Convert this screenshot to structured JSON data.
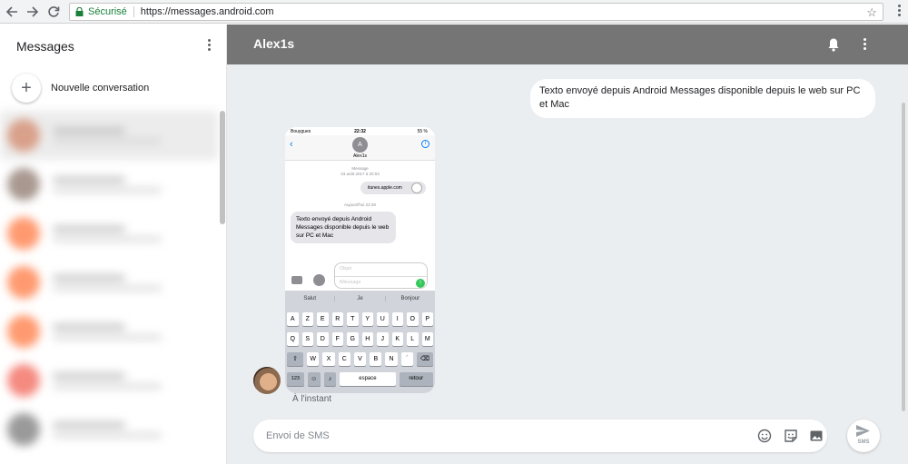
{
  "browser": {
    "secure_label": "Sécurisé",
    "url": "https://messages.android.com"
  },
  "sidebar": {
    "title": "Messages",
    "new_conversation_label": "Nouvelle conversation"
  },
  "conversation": {
    "title": "Alex1s",
    "sent_message": "Texto envoyé depuis Android Messages disponible depuis le web sur PC et Mac",
    "received_timestamp": "À l'instant"
  },
  "phone_screenshot": {
    "carrier": "Bouygues",
    "time": "22:32",
    "battery": "55 %",
    "contact_initial": "A",
    "contact_name": "Alex1s",
    "date_label_1": "Message",
    "date_label_2": "23 août 2017 à 20:03",
    "link_preview": "itunes.apple.com",
    "today_label": "Aujourd'hui 22:28",
    "message_text": "Texto envoyé depuis Android Messages disponible depuis le web sur PC et Mac",
    "subject_placeholder": "Objet",
    "message_placeholder": "iMessage",
    "suggestions": [
      "Salut",
      "Je",
      "Bonjour"
    ],
    "keyboard_row1": [
      "A",
      "Z",
      "E",
      "R",
      "T",
      "Y",
      "U",
      "I",
      "O",
      "P"
    ],
    "keyboard_row2": [
      "Q",
      "S",
      "D",
      "F",
      "G",
      "H",
      "J",
      "K",
      "L",
      "M"
    ],
    "keyboard_row3": [
      "W",
      "X",
      "C",
      "V",
      "B",
      "N",
      "´"
    ],
    "key_numbers": "123",
    "key_space": "espace",
    "key_return": "retour"
  },
  "composer": {
    "placeholder": "Envoi de SMS",
    "send_label": "SMS"
  },
  "colors": {
    "header_bg": "#757575",
    "conversation_bg": "#ebeef1",
    "secure_green": "#188038",
    "ios_blue": "#007aff"
  }
}
